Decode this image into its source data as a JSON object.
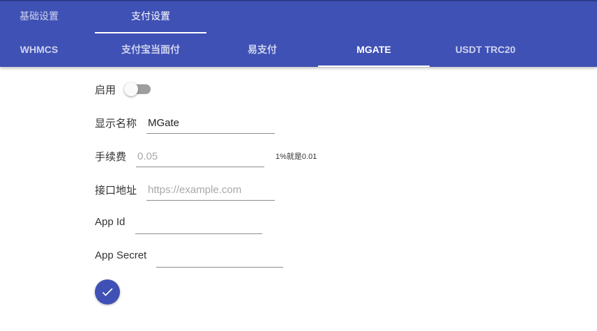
{
  "header": {
    "main_tabs": [
      {
        "label": "基础设置",
        "active": false
      },
      {
        "label": "支付设置",
        "active": true
      }
    ],
    "payment_tabs": [
      {
        "label": "WHMCS",
        "active": false
      },
      {
        "label": "支付宝当面付",
        "active": false
      },
      {
        "label": "易支付",
        "active": false
      },
      {
        "label": "MGATE",
        "active": true
      },
      {
        "label": "USDT TRC20",
        "active": false
      }
    ]
  },
  "form": {
    "enable": {
      "label": "启用",
      "value": false
    },
    "display_name": {
      "label": "显示名称",
      "value": "MGate",
      "placeholder": ""
    },
    "fee": {
      "label": "手续费",
      "value": "",
      "placeholder": "0.05",
      "hint": "1%就是0.01"
    },
    "api_url": {
      "label": "接口地址",
      "value": "",
      "placeholder": "https://example.com"
    },
    "app_id": {
      "label": "App Id",
      "value": "",
      "placeholder": ""
    },
    "app_secret": {
      "label": "App Secret",
      "value": "",
      "placeholder": ""
    },
    "submit_icon": "check-icon"
  },
  "colors": {
    "primary": "#3f51b5",
    "toggle_track": "#9e9e9e",
    "field_line": "#8c8c8c"
  }
}
